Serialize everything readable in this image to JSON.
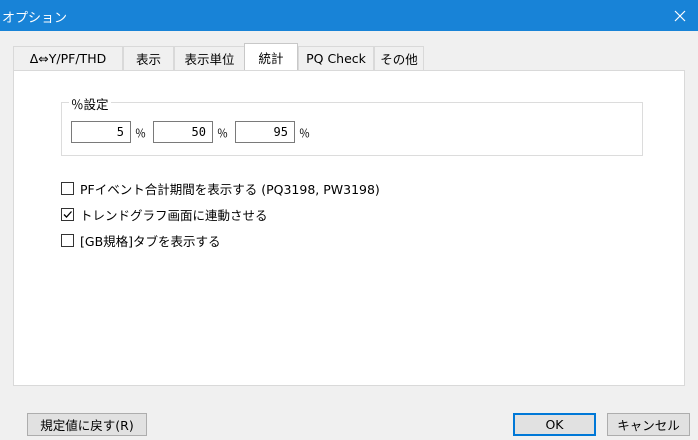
{
  "window": {
    "title": "オプション",
    "close_glyph": "✕"
  },
  "tabs": [
    {
      "label": "Δ⇔Y/PF/THD",
      "active": false
    },
    {
      "label": "表示",
      "active": false
    },
    {
      "label": "表示単位",
      "active": false
    },
    {
      "label": "統計",
      "active": true
    },
    {
      "label": "PQ Check",
      "active": false
    },
    {
      "label": "その他",
      "active": false
    }
  ],
  "percent_settings": {
    "legend": "％設定",
    "unit": "％",
    "values": [
      "5",
      "50",
      "95"
    ]
  },
  "options": [
    {
      "label": "PFイベント合計期間を表示する (PQ3198, PW3198)",
      "checked": false
    },
    {
      "label": "トレンドグラフ画面に連動させる",
      "checked": true
    },
    {
      "label": "[GB規格]タブを表示する",
      "checked": false
    }
  ],
  "buttons": {
    "reset": "規定値に戻す(R)",
    "ok": "OK",
    "cancel": "キャンセル"
  },
  "colors": {
    "titlebar": "#1883d7",
    "default_button_border": "#0078d7"
  }
}
